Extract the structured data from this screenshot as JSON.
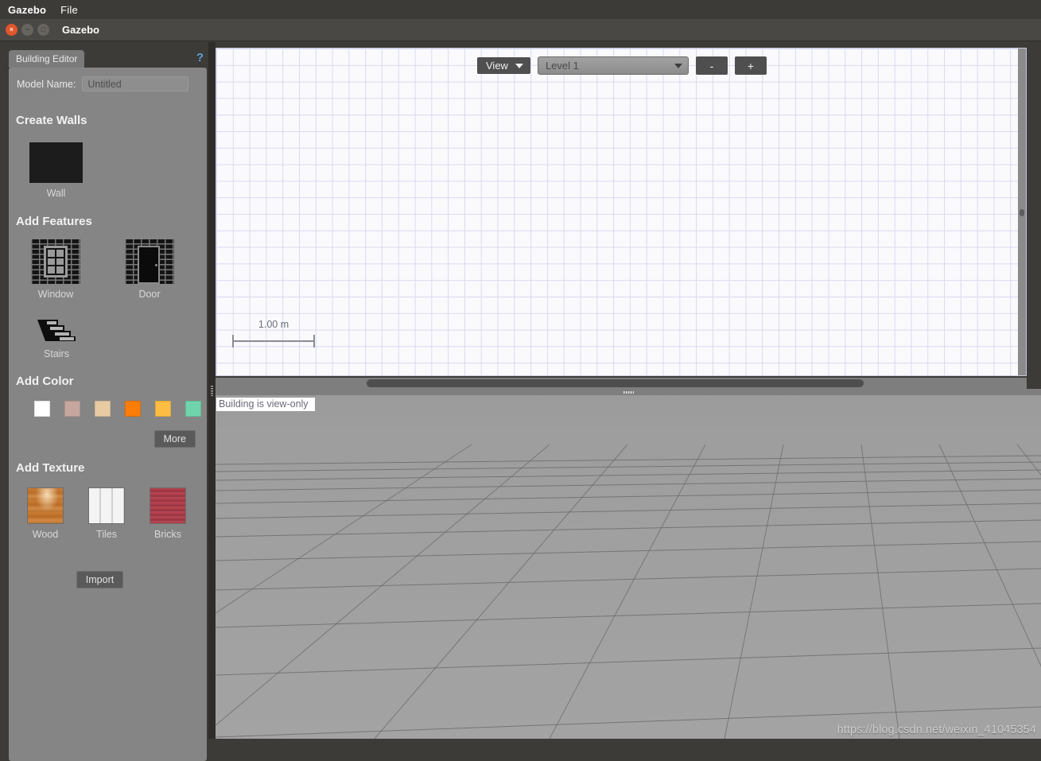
{
  "menubar": {
    "app_name": "Gazebo",
    "file_menu": "File"
  },
  "titlebar": {
    "title": "Gazebo",
    "close_glyph": "×",
    "minimize_glyph": "−",
    "maximize_glyph": "□"
  },
  "left_panel": {
    "tab_label": "Building Editor",
    "help_glyph": "?",
    "model_name_label": "Model Name:",
    "model_name_value": "Untitled",
    "model_name_placeholder": "Untitled",
    "sections": {
      "create_walls": {
        "heading": "Create Walls",
        "items": [
          {
            "label": "Wall",
            "icon": "wall-icon"
          }
        ]
      },
      "add_features": {
        "heading": "Add Features",
        "items": [
          {
            "label": "Window",
            "icon": "window-icon"
          },
          {
            "label": "Door",
            "icon": "door-icon"
          },
          {
            "label": "Stairs",
            "icon": "stairs-icon"
          }
        ]
      },
      "add_color": {
        "heading": "Add Color",
        "swatches": [
          {
            "name": "white",
            "hex": "#ffffff"
          },
          {
            "name": "rose",
            "hex": "#c5a79f"
          },
          {
            "name": "tan",
            "hex": "#e8cba3"
          },
          {
            "name": "orange",
            "hex": "#fb7c06"
          },
          {
            "name": "amber",
            "hex": "#fcbd42"
          },
          {
            "name": "mint",
            "hex": "#6fd3ab"
          }
        ],
        "more_label": "More"
      },
      "add_texture": {
        "heading": "Add Texture",
        "items": [
          {
            "label": "Wood",
            "icon": "wood-texture"
          },
          {
            "label": "Tiles",
            "icon": "tiles-texture"
          },
          {
            "label": "Bricks",
            "icon": "bricks-texture"
          }
        ],
        "import_label": "Import"
      }
    }
  },
  "editor_2d": {
    "toolbar": {
      "view_label": "View",
      "level_value": "Level 1",
      "zoom_out_label": "-",
      "zoom_in_label": "+"
    },
    "scale_label": "1.00 m"
  },
  "view_3d": {
    "status_label": "Building is view-only"
  },
  "watermark": "https://blog.csdn.net/weixin_41045354"
}
